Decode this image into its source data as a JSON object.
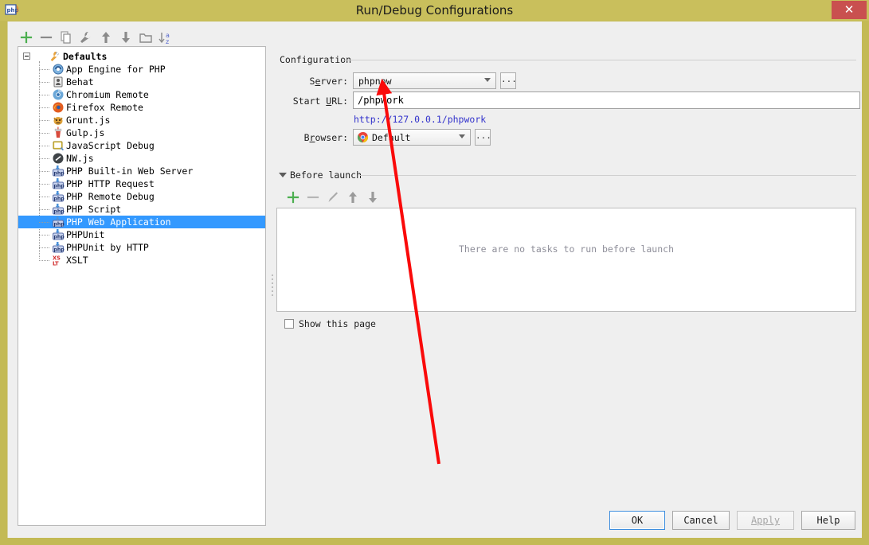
{
  "window": {
    "title": "Run/Debug Configurations",
    "app_icon": "php-storm-icon",
    "close_label": "✕"
  },
  "left_toolbar": {
    "items": [
      {
        "name": "add-configuration-button",
        "icon": "plus-icon",
        "tooltip": "Add New Configuration"
      },
      {
        "name": "remove-configuration-button",
        "icon": "minus-icon",
        "tooltip": "Remove Configuration"
      },
      {
        "name": "copy-configuration-button",
        "icon": "copy-icon",
        "tooltip": "Copy Configuration"
      },
      {
        "name": "edit-defaults-button",
        "icon": "wrench-icon",
        "tooltip": "Edit defaults"
      },
      {
        "name": "move-up-button",
        "icon": "arrow-up-icon",
        "tooltip": "Move Up"
      },
      {
        "name": "move-down-button",
        "icon": "arrow-down-icon",
        "tooltip": "Move Down"
      },
      {
        "name": "create-folder-button",
        "icon": "folder-icon",
        "tooltip": "Create New Folder"
      },
      {
        "name": "sort-configurations-button",
        "icon": "sort-az-icon",
        "tooltip": "Sort Configurations"
      }
    ]
  },
  "tree": {
    "root": {
      "label": "Defaults",
      "icon": "wrench-icon",
      "expanded": true
    },
    "items": [
      {
        "label": "App Engine for PHP",
        "icon": "app-engine-icon",
        "selected": false
      },
      {
        "label": "Behat",
        "icon": "behat-icon",
        "selected": false
      },
      {
        "label": "Chromium Remote",
        "icon": "chromium-icon",
        "selected": false
      },
      {
        "label": "Firefox Remote",
        "icon": "firefox-icon",
        "selected": false
      },
      {
        "label": "Grunt.js",
        "icon": "grunt-icon",
        "selected": false
      },
      {
        "label": "Gulp.js",
        "icon": "gulp-icon",
        "selected": false
      },
      {
        "label": "JavaScript Debug",
        "icon": "javascript-debug-icon",
        "selected": false
      },
      {
        "label": "NW.js",
        "icon": "nwjs-icon",
        "selected": false
      },
      {
        "label": "PHP Built-in Web Server",
        "icon": "php-icon",
        "selected": false
      },
      {
        "label": "PHP HTTP Request",
        "icon": "php-icon",
        "selected": false
      },
      {
        "label": "PHP Remote Debug",
        "icon": "php-icon",
        "selected": false
      },
      {
        "label": "PHP Script",
        "icon": "php-icon",
        "selected": false
      },
      {
        "label": "PHP Web Application",
        "icon": "php-icon",
        "selected": true
      },
      {
        "label": "PHPUnit",
        "icon": "php-icon",
        "selected": false
      },
      {
        "label": "PHPUnit by HTTP",
        "icon": "php-icon",
        "selected": false
      },
      {
        "label": "XSLT",
        "icon": "xslt-icon",
        "selected": false
      }
    ]
  },
  "configuration": {
    "group_label": "Configuration",
    "server": {
      "label_pre": "S",
      "label_key": "e",
      "label_post": "rver:",
      "label_full": "Server:",
      "value": "phpnow",
      "browse_label": "..."
    },
    "start_url": {
      "label_full": "Start URL:",
      "label_pre": "Start ",
      "label_key": "U",
      "label_post": "RL:",
      "value": "/phpwork"
    },
    "resolved_url": "http://127.0.0.1/phpwork",
    "browser": {
      "label_full": "Browser:",
      "label_pre": "B",
      "label_key": "r",
      "label_post": "owser:",
      "value": "Default",
      "icon": "chrome-icon",
      "browse_label": "..."
    }
  },
  "before_launch": {
    "group_label": "Before launch",
    "toolbar": [
      {
        "name": "add-task-button",
        "icon": "plus-icon"
      },
      {
        "name": "remove-task-button",
        "icon": "minus-icon"
      },
      {
        "name": "edit-task-button",
        "icon": "pencil-icon"
      },
      {
        "name": "move-task-up-button",
        "icon": "arrow-up-icon"
      },
      {
        "name": "move-task-down-button",
        "icon": "arrow-down-icon"
      }
    ],
    "empty_text": "There are no tasks to run before launch",
    "show_page": {
      "label": "Show this page",
      "checked": false
    }
  },
  "footer": {
    "ok": "OK",
    "cancel": "Cancel",
    "apply": "Apply",
    "apply_disabled": true,
    "help": "Help"
  },
  "annotation": {
    "arrow_color": "#fa0a0a",
    "type": "arrow-pointing-to-start-url"
  },
  "colors": {
    "titlebar": "#c9bf5c",
    "close_button": "#c9504f",
    "selection": "#3399ff",
    "link": "#3333cc",
    "panel": "#efefef"
  }
}
